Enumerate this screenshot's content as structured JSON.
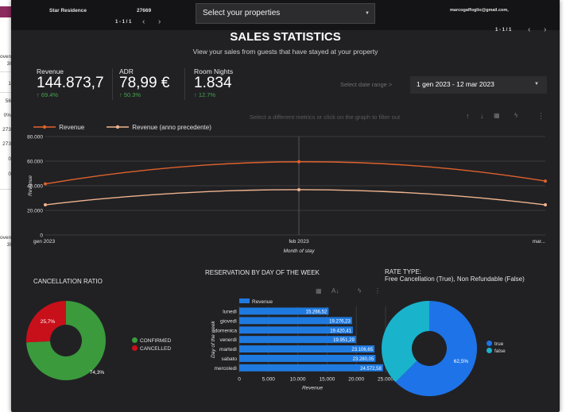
{
  "topbar": {
    "property_name": "Star Residence",
    "property_id": "27669",
    "left_pager": "1 - 1 / 1",
    "property_select": "Select your properties",
    "email": "marcogaffoglio@gmail.com,",
    "right_pager": "1 - 1 / 1"
  },
  "background": {
    "left_cells": [
      "oven",
      "3I",
      "1",
      "56",
      "0%",
      "273",
      "273",
      "0",
      "0",
      "oven",
      "3I"
    ]
  },
  "header": {
    "title": "SALES STATISTICS",
    "subtitle": "View your sales from guests that have stayed at your property"
  },
  "kpis": [
    {
      "label": "Revenue",
      "value": "144.873,7",
      "delta": "↑ 69.4%"
    },
    {
      "label": "ADR",
      "value": "78,99 €",
      "delta": "↑ 50.3%"
    },
    {
      "label": "Room Nights",
      "value": "1.834",
      "delta": "↑ 12.7%"
    }
  ],
  "date": {
    "label": "Select date range  >",
    "value": "1 gen 2023 - 12 mar 2023"
  },
  "hint": "Select a different metrics or click on the graph to filter out",
  "toolbar_icons": [
    "arrow-up-icon",
    "arrow-down-icon",
    "chart-options-icon",
    "lightning-icon",
    "more-vert-icon"
  ],
  "colors": {
    "revenue": "#e0622c",
    "prev_revenue": "#f0b48e",
    "bar": "#1f7ae0",
    "confirmed": "#3a9a3c",
    "cancelled": "#c8101a",
    "true": "#1e73e8",
    "false": "#19b3cc"
  },
  "chart_data": [
    {
      "type": "line",
      "series": [
        {
          "name": "Revenue",
          "values": [
            41500,
            59500,
            43800
          ]
        },
        {
          "name": "Revenue (anno precedente)",
          "values": [
            24500,
            36800,
            24500
          ]
        }
      ],
      "x": [
        "gen 2023",
        "feb 2023",
        "mar..."
      ],
      "xlabel": "Month of stay",
      "ylabel": "Revenue",
      "yticks": [
        "0",
        "20.000",
        "40.000",
        "60.000",
        "80.000"
      ],
      "ylim": [
        0,
        80000
      ],
      "grid": true,
      "legend": "top-left"
    },
    {
      "type": "pie",
      "title": "CANCELLATION RATIO",
      "labels": [
        "CONFIRMED",
        "CANCELLED"
      ],
      "values": [
        74.3,
        25.7
      ],
      "value_labels": [
        "74,3%",
        "25,7%"
      ],
      "donut": true,
      "legend": "right"
    },
    {
      "type": "bar",
      "orientation": "horizontal",
      "title": "RESERVATION BY DAY OF THE WEEK",
      "categories": [
        "lunedì",
        "giovedì",
        "domenica",
        "venerdì",
        "martedì",
        "sabato",
        "mercoledì"
      ],
      "series": [
        {
          "name": "Revenue",
          "values": [
            15266.52,
            19276.23,
            19420.41,
            19951.29,
            23106.65,
            23280.05,
            24572.58
          ]
        }
      ],
      "value_labels": [
        "15.266,52",
        "19.276,23",
        "19.420,41",
        "19.951,29",
        "23.106,65",
        "23.280,05",
        "24.572,58"
      ],
      "xticks": [
        "0",
        "5.000",
        "10.000",
        "15.000",
        "20.000",
        "25.000"
      ],
      "xlim": [
        0,
        25000
      ],
      "xlabel": "Revenue",
      "ylabel": "Day of the week",
      "legend": "top-left"
    },
    {
      "type": "pie",
      "title": "RATE TYPE:",
      "subtitle": "Free Cancellation (True), Non Refundable (False)",
      "labels": [
        "true",
        "false"
      ],
      "values": [
        62.5,
        37.5
      ],
      "value_labels": [
        "62,5%",
        "37,5%"
      ],
      "donut": true,
      "legend": "right"
    }
  ]
}
